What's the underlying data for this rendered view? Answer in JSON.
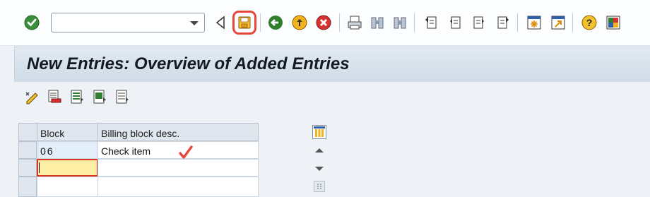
{
  "toolbar": {
    "command_field": {
      "value": "",
      "placeholder": ""
    },
    "icons": [
      "enter-icon",
      "command-dropdown-icon",
      "collapse-arrow-icon",
      "save-icon",
      "back-icon",
      "exit-icon",
      "cancel-icon",
      "print-icon",
      "find-icon",
      "find-next-icon",
      "first-page-icon",
      "previous-page-icon",
      "next-page-icon",
      "last-page-icon",
      "create-session-icon",
      "shortcut-icon",
      "help-icon",
      "customize-layout-icon"
    ]
  },
  "title": "New Entries: Overview of Added Entries",
  "app_toolbar": {
    "icons": [
      "change-display-icon",
      "delete-icon",
      "select-all-icon",
      "select-block-icon",
      "deselect-all-icon"
    ]
  },
  "table": {
    "columns": [
      "Block",
      "Billing block desc."
    ],
    "rows": [
      {
        "block": "06",
        "desc": "Check item"
      },
      {
        "block": "",
        "desc": ""
      },
      {
        "block": "",
        "desc": ""
      }
    ]
  },
  "annotations": {
    "checkmark_color": "#e8453c",
    "highlight_color": "#e8453c"
  }
}
